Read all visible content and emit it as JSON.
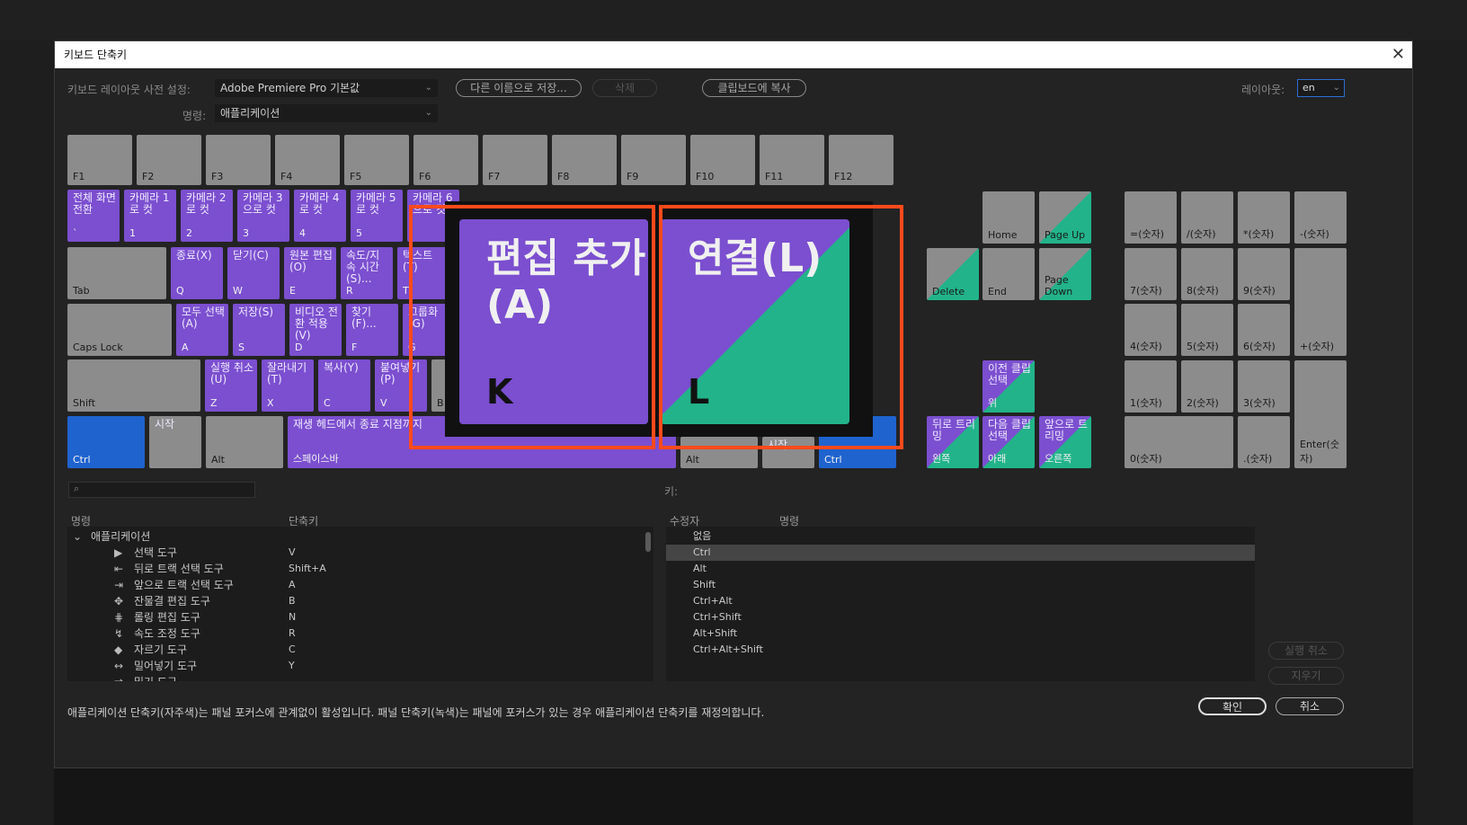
{
  "window": {
    "title": "키보드 단축키",
    "close": "✕"
  },
  "preset": {
    "label": "키보드 레이아웃 사전 설정:",
    "value": "Adobe Premiere Pro 기본값"
  },
  "command": {
    "label": "명령:",
    "value": "애플리케이션"
  },
  "buttons": {
    "save_as": "다른 이름으로 저장...",
    "delete": "삭제",
    "copy_clipboard": "클립보드에 복사",
    "ok": "확인",
    "cancel": "취소",
    "undo": "실행 취소",
    "clear": "지우기"
  },
  "layout": {
    "label": "레이아웃:",
    "value": "en"
  },
  "fkeys": [
    "F1",
    "F2",
    "F3",
    "F4",
    "F5",
    "F6",
    "F7",
    "F8",
    "F9",
    "F10",
    "F11",
    "F12"
  ],
  "row1": [
    {
      "cmd": "전체 화면 전환",
      "key": "`"
    },
    {
      "cmd": "카메라 1로 컷",
      "key": "1"
    },
    {
      "cmd": "카메라 2로 컷",
      "key": "2"
    },
    {
      "cmd": "카메라 3으로 컷",
      "key": "3"
    },
    {
      "cmd": "카메라 4로 컷",
      "key": "4"
    },
    {
      "cmd": "카메라 5로 컷",
      "key": "5"
    },
    {
      "cmd": "카메라 6으로 컷",
      "key": ""
    }
  ],
  "row2": [
    {
      "cmd": "",
      "key": "Tab"
    },
    {
      "cmd": "종료(X)",
      "key": "Q"
    },
    {
      "cmd": "닫기(C)",
      "key": "W"
    },
    {
      "cmd": "원본 편집(O)",
      "key": "E"
    },
    {
      "cmd": "속도/지속 시간(S)...",
      "key": "R"
    },
    {
      "cmd": "텍스트(T)",
      "key": "T"
    }
  ],
  "row3": [
    {
      "cmd": "",
      "key": "Caps Lock"
    },
    {
      "cmd": "모두 선택(A)",
      "key": "A"
    },
    {
      "cmd": "저장(S)",
      "key": "S"
    },
    {
      "cmd": "비디오 전환 적용(V)",
      "key": "D"
    },
    {
      "cmd": "찾기(F)...",
      "key": "F"
    },
    {
      "cmd": "그룹화(G)",
      "key": "G"
    }
  ],
  "row4": [
    {
      "cmd": "",
      "key": "Shift"
    },
    {
      "cmd": "실행 취소(U)",
      "key": "Z"
    },
    {
      "cmd": "잘라내기(T)",
      "key": "X"
    },
    {
      "cmd": "복사(Y)",
      "key": "C"
    },
    {
      "cmd": "붙여넣기(P)",
      "key": "V"
    },
    {
      "cmd": "",
      "key": "B"
    }
  ],
  "row5": {
    "ctrl_left": "Ctrl",
    "win": "시작",
    "alt_left": "Alt",
    "space_cmd": "재생 헤드에서 종료 지점까지",
    "space_key": "스페이스바",
    "alt_right": "Alt",
    "win_right": "시작",
    "ctrl_right": "Ctrl"
  },
  "zoom_keys": [
    {
      "cmd": "편집 추가(A)",
      "key": "K"
    },
    {
      "cmd": "연결(L)",
      "key": "L"
    }
  ],
  "nav": {
    "home": "Home",
    "pgup": "Page Up",
    "delete": "Delete",
    "end": "End",
    "pgdn": "Page Down",
    "up_cmd": "이전 클립 선택",
    "up_key": "위",
    "left_cmd": "뒤로 트리밍",
    "left_key": "왼쪽",
    "down_cmd": "다음 클립 선택",
    "down_key": "아래",
    "right_cmd": "앞으로 트리밍",
    "right_key": "오른쪽"
  },
  "numpad": [
    "=(숫자)",
    "/(숫자)",
    "*(숫자)",
    "-(숫자)",
    "7(숫자)",
    "8(숫자)",
    "9(숫자)",
    "+(숫자)",
    "4(숫자)",
    "5(숫자)",
    "6(숫자)",
    "1(숫자)",
    "2(숫자)",
    "3(숫자)",
    "Enter(숫자)",
    "0(숫자)",
    ".(숫자)"
  ],
  "key_label": "키:",
  "left_table": {
    "col_name": "명령",
    "col_shortcut": "단축키",
    "group": "애플리케이션",
    "rows": [
      {
        "icon": "▶",
        "name": "선택 도구",
        "sc": "V"
      },
      {
        "icon": "⇤",
        "name": "뒤로 트랙 선택 도구",
        "sc": "Shift+A"
      },
      {
        "icon": "⇥",
        "name": "앞으로 트랙 선택 도구",
        "sc": "A"
      },
      {
        "icon": "✥",
        "name": "잔물결 편집 도구",
        "sc": "B"
      },
      {
        "icon": "⋕",
        "name": "롤링 편집 도구",
        "sc": "N"
      },
      {
        "icon": "↯",
        "name": "속도 조정 도구",
        "sc": "R"
      },
      {
        "icon": "◆",
        "name": "자르기 도구",
        "sc": "C"
      },
      {
        "icon": "↔",
        "name": "밀어넣기 도구",
        "sc": "Y"
      },
      {
        "icon": "⇌",
        "name": "밀기 도구",
        "sc": ""
      }
    ]
  },
  "right_table": {
    "col_modifier": "수정자",
    "col_name": "명령",
    "rows": [
      "없음",
      "Ctrl",
      "Alt",
      "Shift",
      "Ctrl+Alt",
      "Ctrl+Shift",
      "Alt+Shift",
      "Ctrl+Alt+Shift"
    ]
  },
  "footer_note": "애플리케이션 단축키(자주색)는 패널 포커스에 관계없이 활성입니다. 패널 단축키(녹색)는 패널에 포커스가 있는 경우 애플리케이션 단축키를 재정의합니다.",
  "colors": {
    "app": "#7b4fcf",
    "panel": "#22b38a",
    "modifier": "#1f63cf",
    "highlight": "#ff4a1c"
  }
}
